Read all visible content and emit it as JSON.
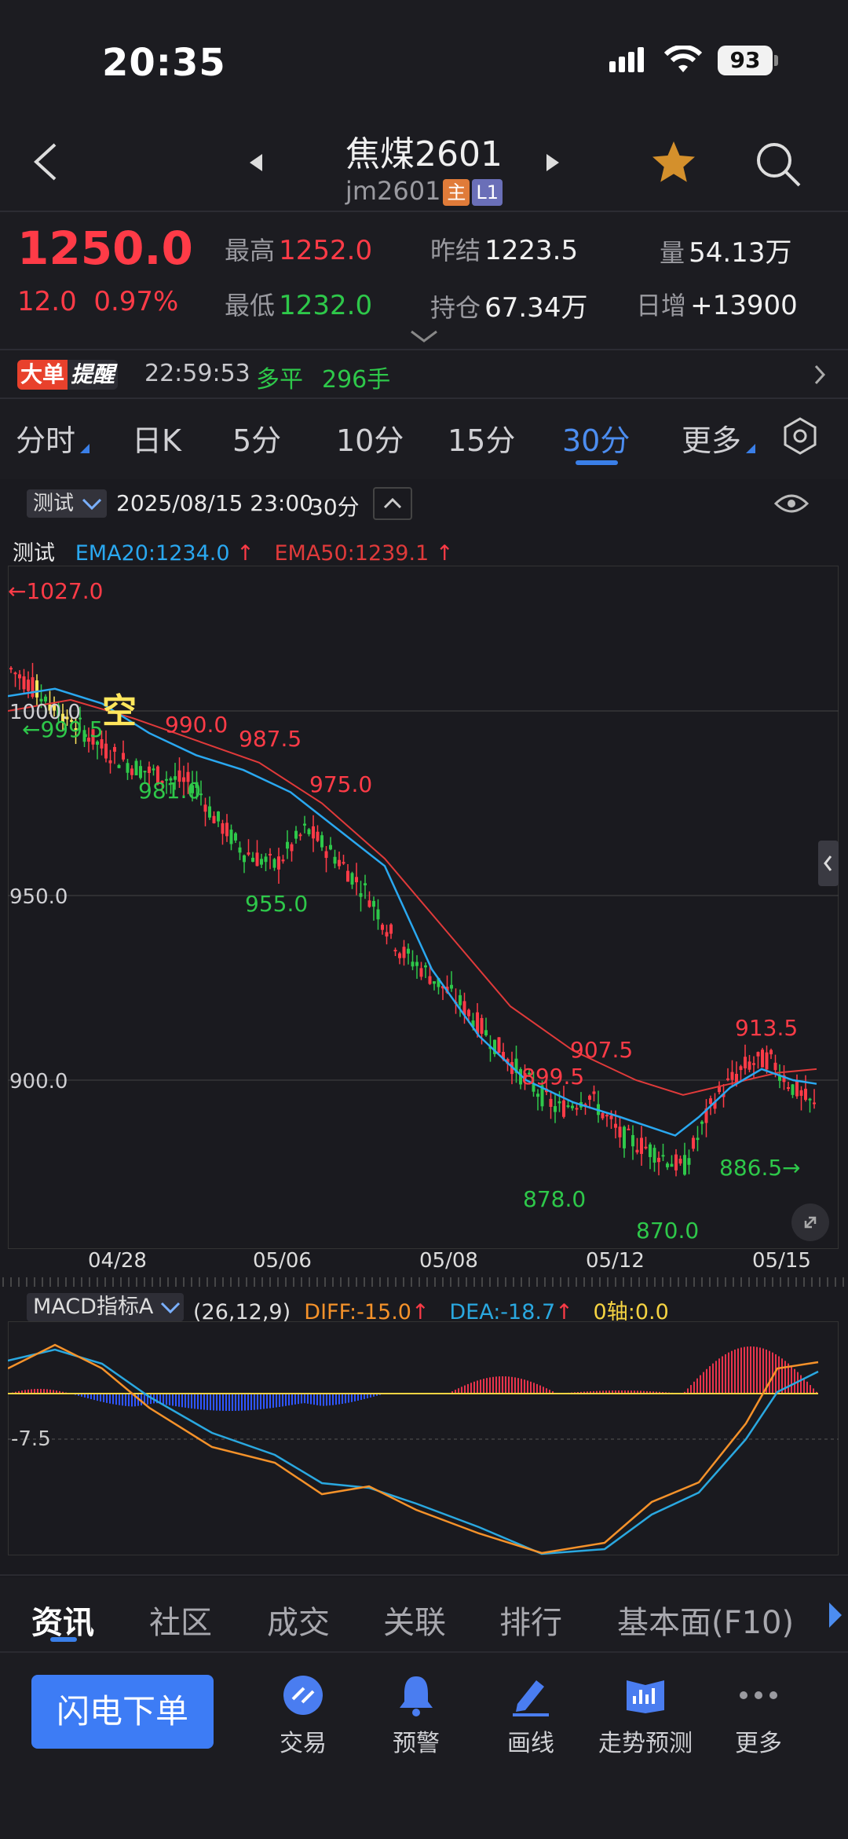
{
  "status": {
    "time": "20:35",
    "battery": "93"
  },
  "header": {
    "title": "焦煤2601",
    "code": "jm2601",
    "tag_main": "主",
    "tag_level": "L1"
  },
  "quote": {
    "price": "1250.0",
    "change": "12.0",
    "change_pct": "0.97%",
    "high_label": "最高",
    "high": "1252.0",
    "low_label": "最低",
    "low": "1232.0",
    "prev_settle_label": "昨结",
    "prev_settle": "1223.5",
    "open_interest_label": "持仓",
    "open_interest": "67.34万",
    "volume_label": "量",
    "volume": "54.13万",
    "daily_increase_label": "日增",
    "daily_increase": "+13900"
  },
  "alert": {
    "badge_a": "大单",
    "badge_b": "提醒",
    "time": "22:59:53",
    "type": "多平",
    "qty": "296手"
  },
  "period_tabs": [
    "分时",
    "日K",
    "5分",
    "10分",
    "15分",
    "30分",
    "更多"
  ],
  "active_period": "30分",
  "chart_header": {
    "indicator": "测试",
    "datetime": "2025/08/15 23:00",
    "period": "30分"
  },
  "ema": {
    "label": "测试",
    "ema20": "EMA20:1234.0",
    "ema50": "EMA50:1239.1"
  },
  "price_axis": [
    "1000.0",
    "950.0",
    "900.0"
  ],
  "date_axis": [
    "04/28",
    "05/06",
    "05/08",
    "05/12",
    "05/15"
  ],
  "annotations": {
    "max_left": "←1027.0",
    "min_left": "←999.5",
    "right_end": "886.5→",
    "p990": "990.0",
    "p987": "987.5",
    "p981": "981.0",
    "p975": "975.0",
    "p955": "955.0",
    "p907": "907.5",
    "p899": "899.5",
    "p878": "878.0",
    "p870": "870.0",
    "p913": "913.5",
    "signal": "空"
  },
  "macd": {
    "indicator": "MACD指标A",
    "params": "(26,12,9)",
    "diff": "DIFF:-15.0",
    "dea": "DEA:-18.7",
    "zero": "0轴:0.0",
    "axis": "-7.5"
  },
  "bottom_tabs": [
    "资讯",
    "社区",
    "成交",
    "关联",
    "排行",
    "基本面(F10)"
  ],
  "actions": {
    "flash_order": "闪电下单",
    "trade": "交易",
    "warning": "预警",
    "draw": "画线",
    "forecast": "走势预测",
    "more": "更多"
  },
  "colors": {
    "up": "#ff3b47",
    "down": "#2ec84a",
    "ema20": "#2aa8f0",
    "ema50": "#e03a3a",
    "accent": "#3d7cf5",
    "diff": "#f5922a",
    "dea": "#2aa8e0",
    "zero": "#f5d342"
  },
  "chart_data": {
    "type": "line",
    "x": [
      "04/28",
      "05/06",
      "05/08",
      "05/12",
      "05/15"
    ],
    "series": [
      {
        "name": "EMA20",
        "values": [
          1004,
          985,
          950,
          890,
          901
        ]
      },
      {
        "name": "EMA50",
        "values": [
          1000,
          990,
          970,
          910,
          903
        ]
      }
    ],
    "ylim": [
      860,
      1030
    ],
    "grid": true,
    "price_labels": [
      1027.0,
      999.5,
      990.0,
      987.5,
      981.0,
      975.0,
      955.0,
      907.5,
      899.5,
      878.0,
      870.0,
      913.5,
      886.5
    ]
  }
}
